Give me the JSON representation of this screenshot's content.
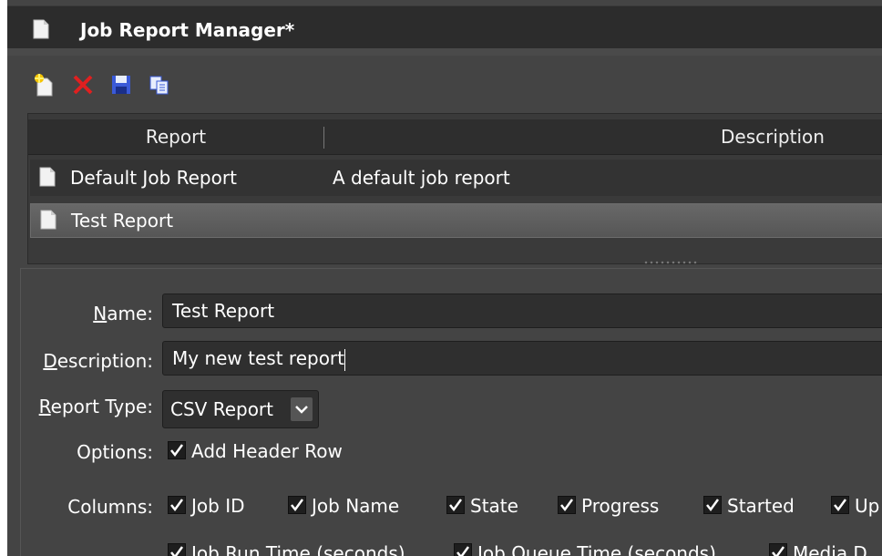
{
  "window": {
    "title": "Job Report Manager*"
  },
  "toolbar": {
    "icons": [
      "new-report-icon",
      "delete-icon",
      "save-icon",
      "copy-icon"
    ]
  },
  "report_list": {
    "headers": {
      "report": "Report",
      "description": "Description"
    },
    "rows": [
      {
        "name": "Default Job Report",
        "description": "A default job report",
        "selected": false
      },
      {
        "name": "Test Report",
        "description": "",
        "selected": true
      }
    ]
  },
  "form": {
    "name": {
      "label_underlined": "N",
      "label_rest": "ame:",
      "value": "Test Report"
    },
    "description": {
      "label_underlined": "D",
      "label_rest": "escription:",
      "value": "My new test report"
    },
    "report_type": {
      "label_underlined": "R",
      "label_rest": "eport Type:",
      "value": "CSV Report"
    },
    "options": {
      "label": "Options:",
      "items": [
        {
          "label": "Add Header Row",
          "checked": true
        }
      ]
    },
    "columns": {
      "label": "Columns:",
      "items": [
        {
          "label": "Job ID",
          "checked": true
        },
        {
          "label": "Job Name",
          "checked": true
        },
        {
          "label": "State",
          "checked": true
        },
        {
          "label": "Progress",
          "checked": true
        },
        {
          "label": "Started",
          "checked": true
        },
        {
          "label": "Up",
          "checked": true
        },
        {
          "label": "Job Run Time (seconds)",
          "checked": true
        },
        {
          "label": "Job Queue Time (seconds)",
          "checked": true
        },
        {
          "label": "Media D",
          "checked": true
        }
      ]
    }
  },
  "colors": {
    "delete_red": "#e02020",
    "save_blue": "#3a5ad8",
    "selected_row": "#5e5e5e"
  }
}
